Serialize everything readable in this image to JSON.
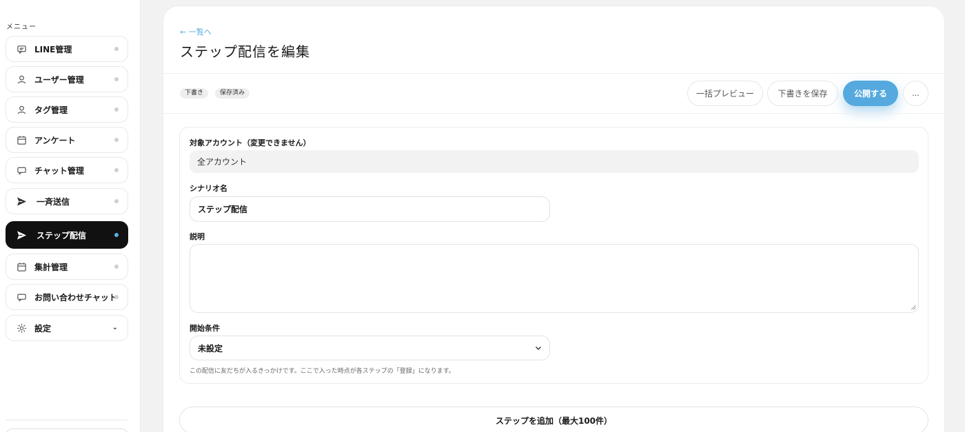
{
  "sidebar": {
    "menu_label": "メニュー",
    "items": [
      {
        "label": "LINE管理",
        "icon": "chat-bubble-icon"
      },
      {
        "label": "ユーザー管理",
        "icon": "user-icon"
      },
      {
        "label": "タグ管理",
        "icon": "user-icon"
      },
      {
        "label": "アンケート",
        "icon": "calendar-icon"
      },
      {
        "label": "チャット管理",
        "icon": "chat-icon"
      },
      {
        "label": "一斉送信",
        "icon": "send-icon"
      },
      {
        "label": "ステップ配信",
        "icon": "send-icon",
        "active": true
      },
      {
        "label": "集計管理",
        "icon": "calendar-icon"
      },
      {
        "label": "お問い合わせチャット",
        "icon": "chat-icon"
      },
      {
        "label": "設定",
        "icon": "gear-icon"
      }
    ],
    "settings_chevron": "⌄"
  },
  "header": {
    "back_link": "← 一覧へ",
    "title": "ステップ配信を編集"
  },
  "toolbar": {
    "badges": [
      "下書き",
      "保存済み"
    ],
    "bulk_preview_label": "一括プレビュー",
    "save_draft_label": "下書きを保存",
    "publish_label": "公開する",
    "more_label": "..."
  },
  "form": {
    "account_label": "対象アカウント（変更できません）",
    "account_value": "全アカウント",
    "scenario_label": "シナリオ名",
    "scenario_value": "ステップ配信",
    "description_label": "説明",
    "description_value": "",
    "start_condition_label": "開始条件",
    "start_condition_value": "未設定",
    "start_condition_help": "この配信に友だちが入るきっかけです。ここで入った時点が各ステップの「登録」になります。"
  },
  "add_step_label": "ステップを追加（最大100件）",
  "colors": {
    "accent": "#55a9de",
    "active_nav_bg": "#111111",
    "active_dot": "#5aaee0"
  }
}
